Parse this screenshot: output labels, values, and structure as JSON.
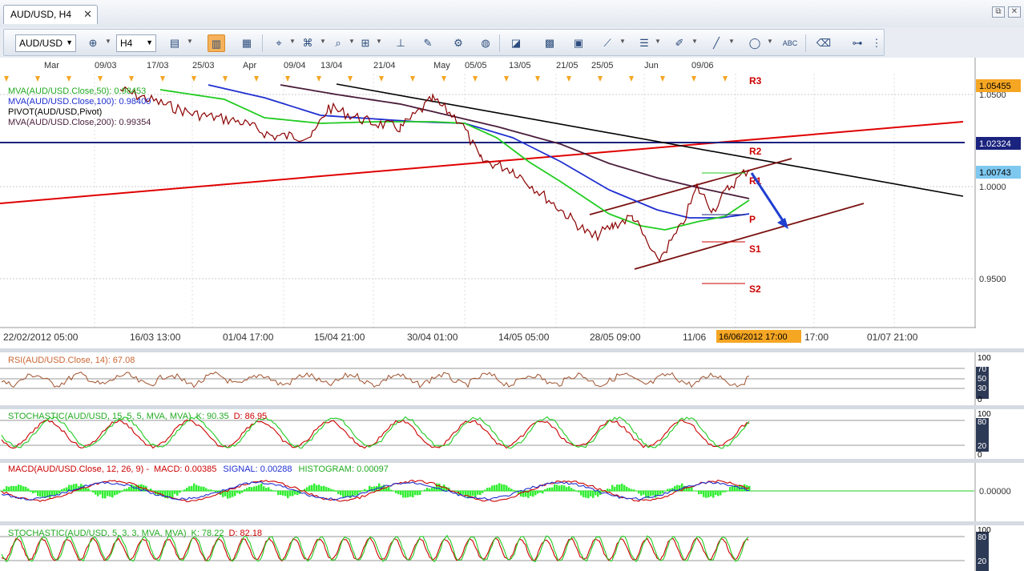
{
  "tab": {
    "title": "AUD/USD, H4",
    "close": "✕"
  },
  "window_buttons": {
    "restore": "⧉",
    "close": "✕"
  },
  "toolbar": {
    "symbol": "AUD/USD",
    "timeframe": "H4",
    "tools": [
      "link-icon",
      "chart-type-icon",
      "bar-chart-icon",
      "candle-icon",
      "mouse-icon",
      "mouse-cursor-icon",
      "zoom-icon",
      "tool-icon",
      "magic-icon",
      "refresh-icon",
      "globe-icon",
      "ruler-icon",
      "image-icon",
      "chart-icon",
      "lines-icon",
      "list-icon",
      "pen-icon",
      "line-icon",
      "ellipse-icon",
      "abc-icon",
      "eraser-icon",
      "tree-icon"
    ]
  },
  "top_dates": [
    "Mar",
    "09/03",
    "17/03",
    "25/03",
    "Apr",
    "09/04",
    "13/04",
    "21/04",
    "May",
    "05/05",
    "13/05",
    "21/05",
    "25/05",
    "Jun",
    "09/06"
  ],
  "indicator_labels": {
    "mva50": "MVA(AUD/USD.Close,50): 0.98453",
    "mva100": "MVA(AUD/USD.Close,100): 0.98400",
    "pivot": "PIVOT(AUD/USD,Pivot)",
    "mva200": "MVA(AUD/USD.Close,200): 0.99354"
  },
  "price_axis": {
    "ticks": [
      "1.0500",
      "1.0000",
      "0.9500"
    ],
    "current_high": "1.05455",
    "level": "1.02324",
    "current": "1.00743"
  },
  "pivot_labels": {
    "r2": "R2",
    "r1": "R1",
    "p": "P",
    "s1": "S1",
    "s2": "S2"
  },
  "bottom_dates": [
    "22/02/2012 05:00",
    "16/03 13:00",
    "01/04 17:00",
    "15/04 21:00",
    "30/04 01:00",
    "14/05 05:00",
    "28/05 09:00",
    "11/06",
    "17:00",
    "01/07 21:00"
  ],
  "cursor_date": "16/06/2012 17:00",
  "rsi": {
    "label": "RSI(AUD/USD.Close, 14): 67.08",
    "ticks": [
      "100",
      "70",
      "50",
      "30",
      "0"
    ]
  },
  "stoch1": {
    "name": "STOCHASTIC(AUD/USD, 15, 5, 5, MVA, MVA)",
    "k": "K: 90.35",
    "d": "D: 86.95",
    "ticks": [
      "100",
      "80",
      "20",
      "0"
    ]
  },
  "macd": {
    "name": "MACD(AUD/USD.Close, 12, 26, 9) -",
    "macd": "MACD: 0.00385",
    "signal": "SIGNAL: 0.00288",
    "histogram": "HISTOGRAM: 0.00097",
    "tick": "0.00000"
  },
  "stoch2": {
    "name": "STOCHASTIC(AUD/USD, 5, 3, 3, MVA, MVA)",
    "k": "K: 78.22",
    "d": "D: 82.18",
    "ticks": [
      "100",
      "80",
      "20"
    ]
  },
  "colors": {
    "accent": "#f5b25a",
    "axis_bg": "#2d3a56",
    "mva50": "#00c000",
    "mva100": "#1f2fd0",
    "pivot": "#cc0000"
  }
}
